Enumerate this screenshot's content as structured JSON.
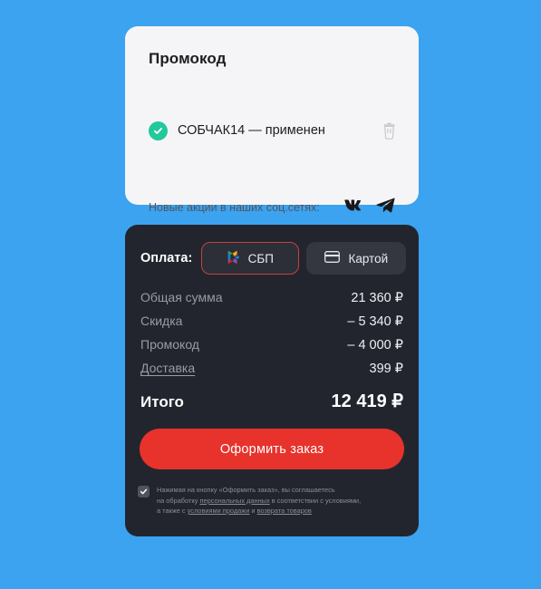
{
  "theme": {
    "page_background": "#3ba3f0",
    "promo_card_background": "#f5f5f7",
    "pay_card_background": "#23252e",
    "accent_red": "#e8332c",
    "success_green": "#21c99b",
    "sbp_border": "#c2443f"
  },
  "promo": {
    "title": "Промокод",
    "check_icon": "check-circle-icon",
    "applied_text": "СОБЧАК14 — применен",
    "delete_icon": "trash-icon",
    "social_label": "Новые акции в наших соц.сетях:",
    "social": [
      {
        "name": "vk-icon",
        "label": "VK"
      },
      {
        "name": "telegram-icon",
        "label": "Telegram"
      }
    ]
  },
  "payment": {
    "label": "Оплата:",
    "methods": [
      {
        "id": "sbp",
        "label": "СБП",
        "icon": "sbp-logo-icon",
        "selected": true
      },
      {
        "id": "card",
        "label": "Картой",
        "icon": "credit-card-icon",
        "selected": false
      }
    ],
    "summary": [
      {
        "label": "Общая сумма",
        "value": "21 360 ₽",
        "link": false
      },
      {
        "label": "Скидка",
        "value": "– 5 340 ₽",
        "link": false
      },
      {
        "label": "Промокод",
        "value": "– 4 000 ₽",
        "link": false
      },
      {
        "label": "Доставка",
        "value": "399 ₽",
        "link": true
      }
    ],
    "total": {
      "label": "Итого",
      "value": "12 419 ₽"
    },
    "submit_label": "Оформить заказ",
    "agreement": {
      "checked": true,
      "line1": "Нажимая на кнопку «Оформить заказ», вы соглашаетесь",
      "line2_pre": "на обработку ",
      "line2_link": "персональных данных",
      "line2_post": " в соответствии с условиями,",
      "line3_pre": "а также с ",
      "line3_link1": "условиями продажи",
      "line3_mid": " и ",
      "line3_link2": "возврата товаров"
    }
  }
}
